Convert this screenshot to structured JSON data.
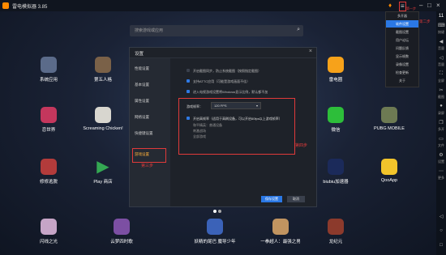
{
  "window": {
    "title": "雷电模拟器 3.85",
    "right_number": "11"
  },
  "search": {
    "placeholder": "搜索游戏或应用"
  },
  "desktop_apps": [
    {
      "label": "系统应用",
      "color": "#5b6b8a"
    },
    {
      "label": "第五人格",
      "color": "#7a6148"
    },
    {
      "label": "雷电圈",
      "color": "#f7a21a"
    },
    {
      "label": "恋世界",
      "color": "#c4375d"
    },
    {
      "label": "Screaming Chicken!",
      "color": "#d8d6cf"
    },
    {
      "label": "微信",
      "color": "#2dbe3a"
    },
    {
      "label": "PUBG MOBILE",
      "color": "#6d7a53"
    },
    {
      "label": "修修逃脱",
      "color": "#b33b3b"
    },
    {
      "label": "Play 商店",
      "color": "#ffffff"
    },
    {
      "label": "biubiu加速器",
      "color": "#1b2a5a"
    },
    {
      "label": "QooApp",
      "color": "#f2c42b"
    },
    {
      "label": "闪线之光",
      "color": "#c6a5c7"
    },
    {
      "label": "云梦四时歌",
      "color": "#7c4fa3"
    },
    {
      "label": "妖精的尾巴 魔导少年",
      "color": "#3b62b8"
    },
    {
      "label": "一拳超人：最强之男",
      "color": "#c19460"
    },
    {
      "label": "龙纪元",
      "color": "#8c3a2c"
    }
  ],
  "settings": {
    "title": "设置",
    "close": "×",
    "nav": [
      "性能设置",
      "基本设置",
      "属性设置",
      "网络设置",
      "快捷键设置",
      "游戏设置"
    ],
    "options": [
      "开启截图同步，防止系统截图（按照指定截图）",
      "支持ATTC应用（可能是游戏画面不佳）",
      "进入电视游戏设置将Windows显示比例，默认都不加"
    ],
    "fps_label": "游戏帧率：",
    "fps_value": "120 FPS",
    "high_fps_label": "开启高帧率（适用于高刷设备，可以开启60fps以上游戏帧率）",
    "high_fps_games": [
      "和平精英：普通设备",
      "刺激战场",
      "全部游戏"
    ],
    "save_label": "保存设置",
    "cancel_label": "取消"
  },
  "steps": {
    "step1": "第一步",
    "step2": "第二步",
    "step3": "第三步",
    "step4": "第四步"
  },
  "menu": {
    "items": [
      "多开器",
      "软件设置",
      "截图设置",
      "用户论坛",
      "问题反馈",
      "显示帧数",
      "录像设置",
      "检查更新",
      "关于"
    ]
  },
  "sidebar": {
    "labels": [
      "按键",
      "音量",
      "音量",
      "全屏",
      "截图",
      "录屏",
      "多开",
      "文件",
      "设置",
      "更多"
    ]
  },
  "colors": {
    "accent": "#2b78e4",
    "highlight": "#e03a3a",
    "nav_active": "#ffb13b"
  }
}
